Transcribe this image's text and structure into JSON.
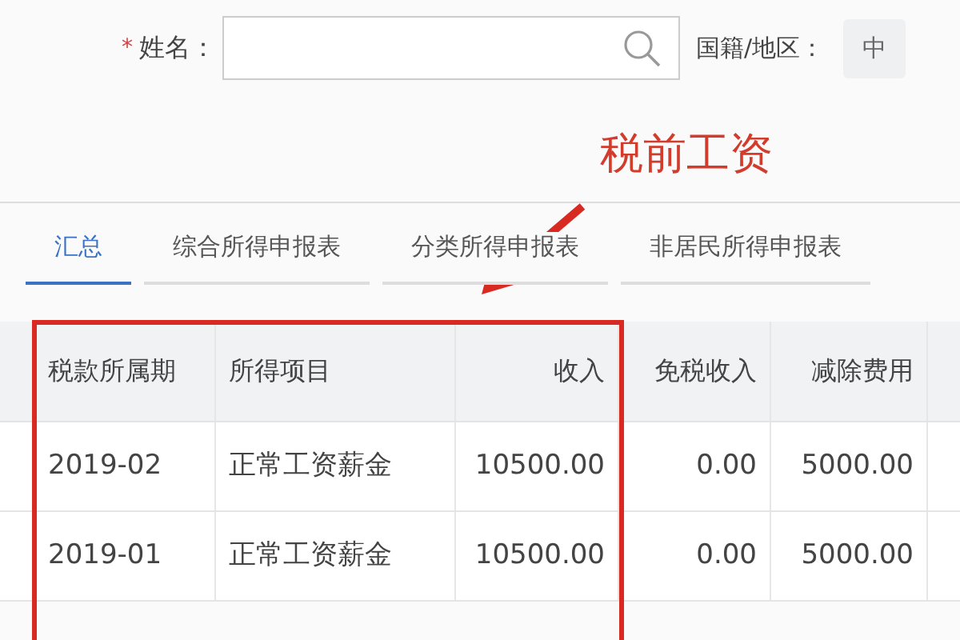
{
  "form": {
    "required_mark": "*",
    "name_label": "姓名：",
    "country_label": "国籍/地区：",
    "country_value": "中"
  },
  "annotation": {
    "text": "税前工资"
  },
  "tabs": [
    {
      "label": "汇总",
      "selected": true
    },
    {
      "label": "综合所得申报表",
      "selected": false
    },
    {
      "label": "分类所得申报表",
      "selected": false
    },
    {
      "label": "非居民所得申报表",
      "selected": false
    }
  ],
  "table": {
    "columns": [
      "税款所属期",
      "所得项目",
      "收入",
      "免税收入",
      "减除费用"
    ],
    "rows": [
      [
        "2019-02",
        "正常工资薪金",
        "10500.00",
        "0.00",
        "5000.00"
      ],
      [
        "2019-01",
        "正常工资薪金",
        "10500.00",
        "0.00",
        "5000.00"
      ]
    ]
  }
}
